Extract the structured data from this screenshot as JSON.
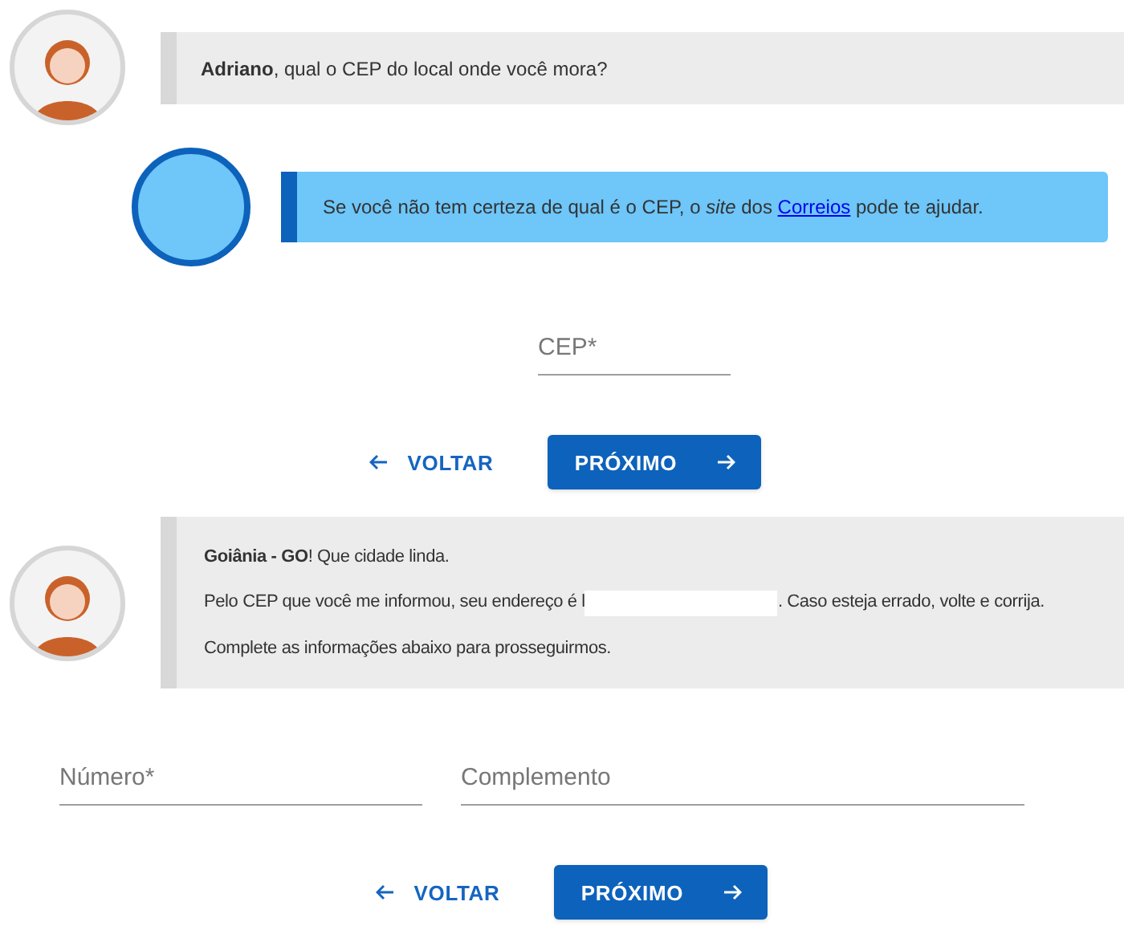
{
  "question": {
    "text": "**Adriano**, qual o CEP do local onde você mora?"
  },
  "hint": {
    "text_before": "Se você não tem certeza de qual é o CEP, o *site* dos ",
    "link": "Correios",
    "text_after": " pode te ajudar."
  },
  "cep_form": {
    "fields": [
      {
        "placeholder": "CEP*"
      }
    ],
    "back_button": "VOLTAR",
    "next_button": "PRÓXIMO"
  },
  "answer": {
    "line_1": "**Goiânia - GO**! Que cidade linda.",
    "line_2_before": "Pelo CEP que você me informou, seu endereço é l",
    "line_2_after": ". Caso esteja errado, volte e corrija.",
    "line_3": "Complete as informações abaixo para prosseguirmos."
  },
  "address_form": {
    "fields": [
      {
        "placeholder": "Número*"
      },
      {
        "placeholder": "Complemento"
      }
    ],
    "back_button": "VOLTAR",
    "next_button": "PRÓXIMO"
  }
}
